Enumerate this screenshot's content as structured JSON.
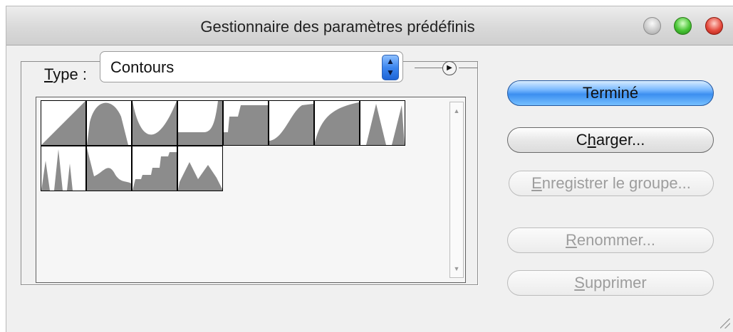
{
  "window": {
    "title": "Gestionnaire des paramètres prédéfinis"
  },
  "type_select": {
    "label_underlined": "T",
    "label_rest": "ype :",
    "value": "Contours"
  },
  "contours": [
    "contour-1",
    "contour-2",
    "contour-3",
    "contour-4",
    "contour-5",
    "contour-6",
    "contour-7",
    "contour-8",
    "contour-9",
    "contour-10",
    "contour-11",
    "contour-12"
  ],
  "buttons": {
    "done": "Terminé",
    "load_pre": "C",
    "load_u": "h",
    "load_post": "arger...",
    "save_u": "E",
    "save_post": "nregistrer le groupe...",
    "rename_u": "R",
    "rename_post": "enommer...",
    "delete_u": "S",
    "delete_post": "upprimer"
  },
  "colors": {
    "primary_button": "#3c8ff0",
    "contour_fill": "#8c8c8c"
  }
}
